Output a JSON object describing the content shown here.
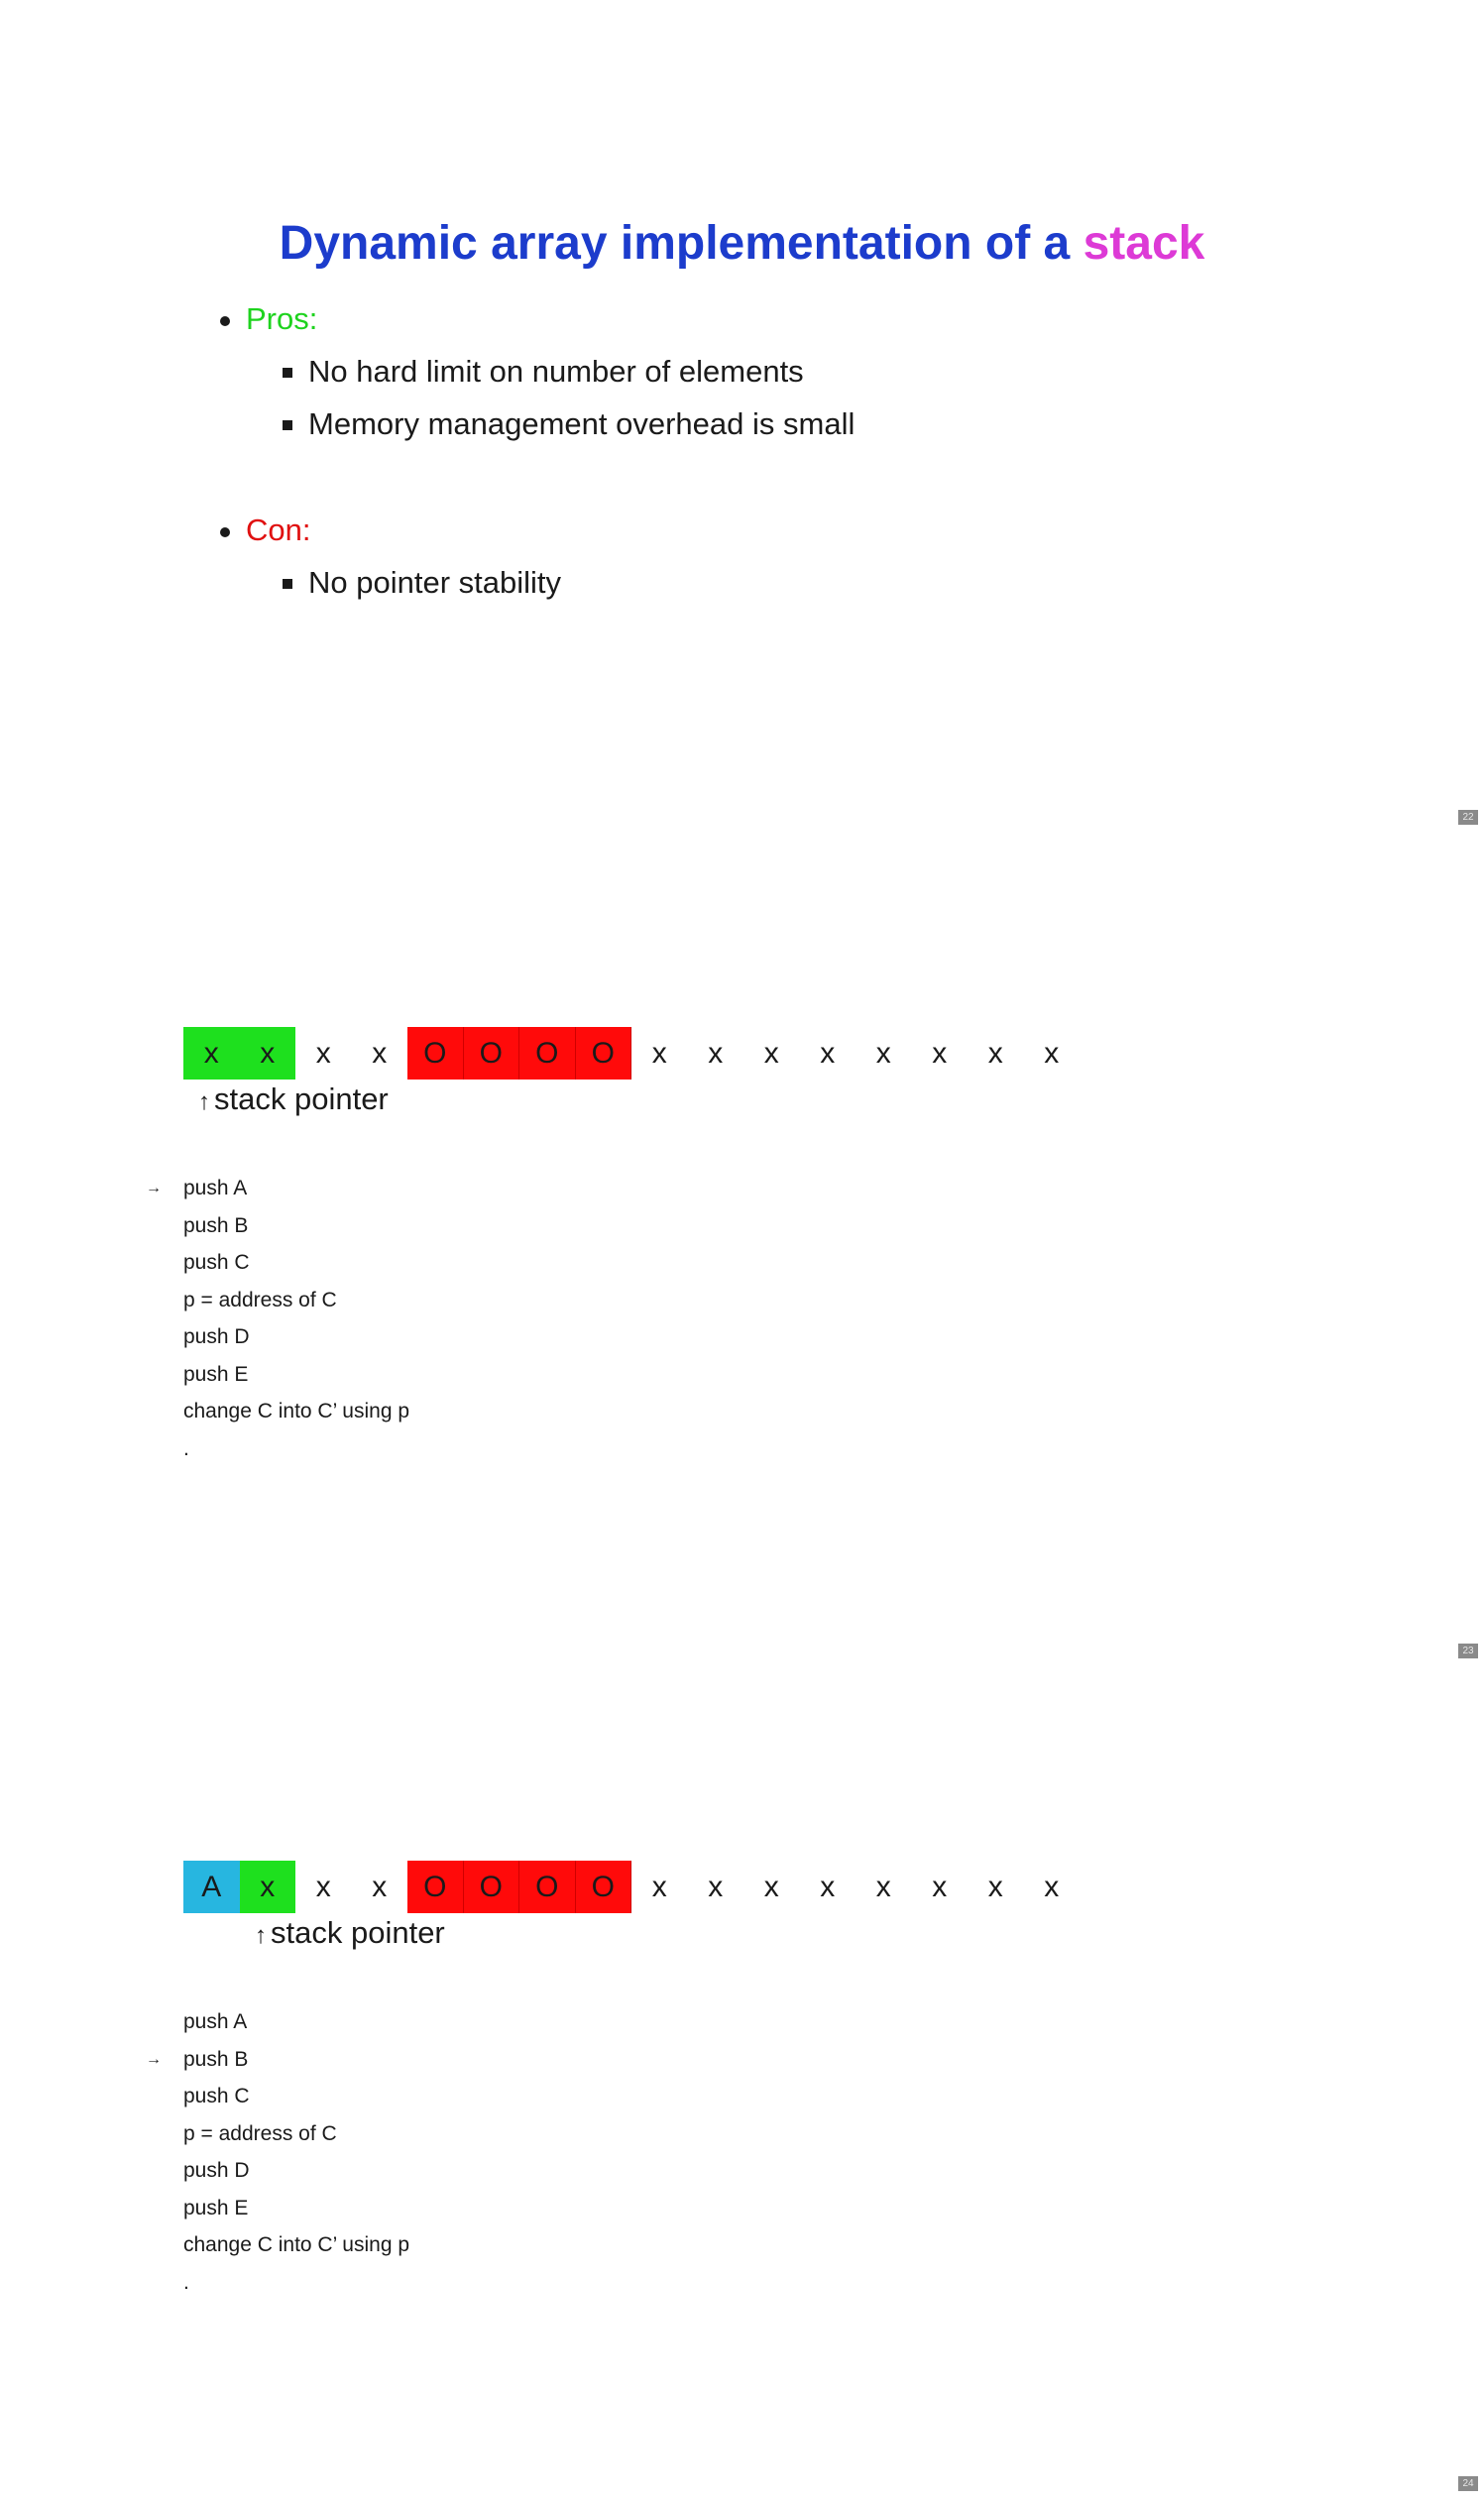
{
  "slide1": {
    "title_main": "Dynamic array implementation of a",
    "title_highlight": "stack",
    "pros_label": "Pros:",
    "pros": [
      "No hard limit on number of elements",
      "Memory management overhead is small"
    ],
    "con_label": "Con:",
    "cons": [
      "No pointer stability"
    ],
    "page": "22"
  },
  "slide2": {
    "cells": [
      "x",
      "x",
      "x",
      "x",
      "O",
      "O",
      "O",
      "O",
      "x",
      "x",
      "x",
      "x",
      "x",
      "x",
      "x",
      "x"
    ],
    "pointer_arrow": "↑",
    "pointer_label": "stack pointer",
    "current_marker": "→",
    "steps": [
      "push A",
      "push B",
      "push C",
      "p = address of C",
      "push D",
      "push E",
      "change C into C’ using p",
      "."
    ],
    "current_step_index": 0,
    "page": "23"
  },
  "slide3": {
    "cells": [
      "A",
      "x",
      "x",
      "x",
      "O",
      "O",
      "O",
      "O",
      "x",
      "x",
      "x",
      "x",
      "x",
      "x",
      "x",
      "x"
    ],
    "pointer_arrow": "↑",
    "pointer_label": "stack pointer",
    "current_marker": "→",
    "steps": [
      "push A",
      "push B",
      "push C",
      "p = address of C",
      "push D",
      "push E",
      "change C into C’ using p",
      "."
    ],
    "current_step_index": 1,
    "page": "24"
  },
  "colors": {
    "title": "#1c3ccc",
    "highlight": "#dd3ad6",
    "pros": "#1ed31e",
    "con": "#e01010",
    "cell_green": "#1ee01e",
    "cell_red": "#ff0a0a",
    "cell_blue": "#27b6e0"
  }
}
